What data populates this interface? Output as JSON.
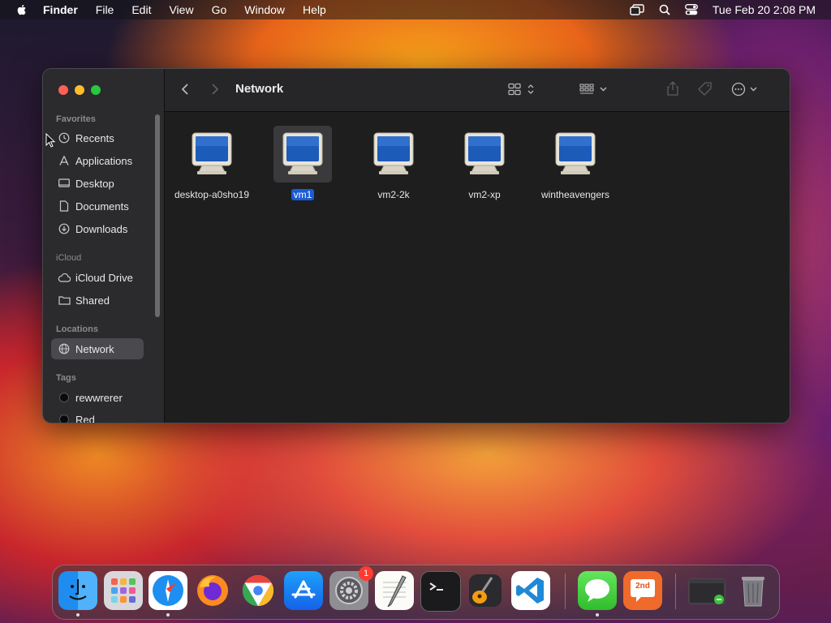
{
  "menubar": {
    "app": "Finder",
    "items": [
      "File",
      "Edit",
      "View",
      "Go",
      "Window",
      "Help"
    ],
    "clock": "Tue Feb 20  2:08 PM"
  },
  "finder": {
    "title": "Network",
    "sidebar": {
      "favorites_title": "Favorites",
      "favorites": [
        {
          "label": "Recents",
          "icon": "clock-icon"
        },
        {
          "label": "Applications",
          "icon": "applications-icon"
        },
        {
          "label": "Desktop",
          "icon": "desktop-icon"
        },
        {
          "label": "Documents",
          "icon": "document-icon"
        },
        {
          "label": "Downloads",
          "icon": "download-icon"
        }
      ],
      "icloud_title": "iCloud",
      "icloud": [
        {
          "label": "iCloud Drive",
          "icon": "cloud-icon"
        },
        {
          "label": "Shared",
          "icon": "shared-folder-icon"
        }
      ],
      "locations_title": "Locations",
      "locations": [
        {
          "label": "Network",
          "icon": "globe-icon",
          "active": true
        }
      ],
      "tags_title": "Tags",
      "tags": [
        {
          "label": "rewwrerer",
          "color": "#000000"
        },
        {
          "label": "Red",
          "color": "#000000"
        }
      ]
    },
    "files": [
      {
        "name": "desktop-a0sho19",
        "selected": false
      },
      {
        "name": "vm1",
        "selected": true
      },
      {
        "name": "vm2-2k",
        "selected": false
      },
      {
        "name": "vm2-xp",
        "selected": false
      },
      {
        "name": "wintheavengers",
        "selected": false
      }
    ]
  },
  "dock": {
    "apps": [
      "Finder",
      "Launchpad",
      "Safari",
      "Firefox",
      "Chrome",
      "App Store",
      "System Settings",
      "TextEdit",
      "Terminal",
      "GarageBand",
      "Visual Studio Code",
      "Messages",
      "2nd",
      "Window",
      "Trash"
    ],
    "settings_badge": "1",
    "second_app_label": "2nd"
  },
  "colors": {
    "selection": "#1a5bd6",
    "sidebar_active": "#4a494d"
  }
}
